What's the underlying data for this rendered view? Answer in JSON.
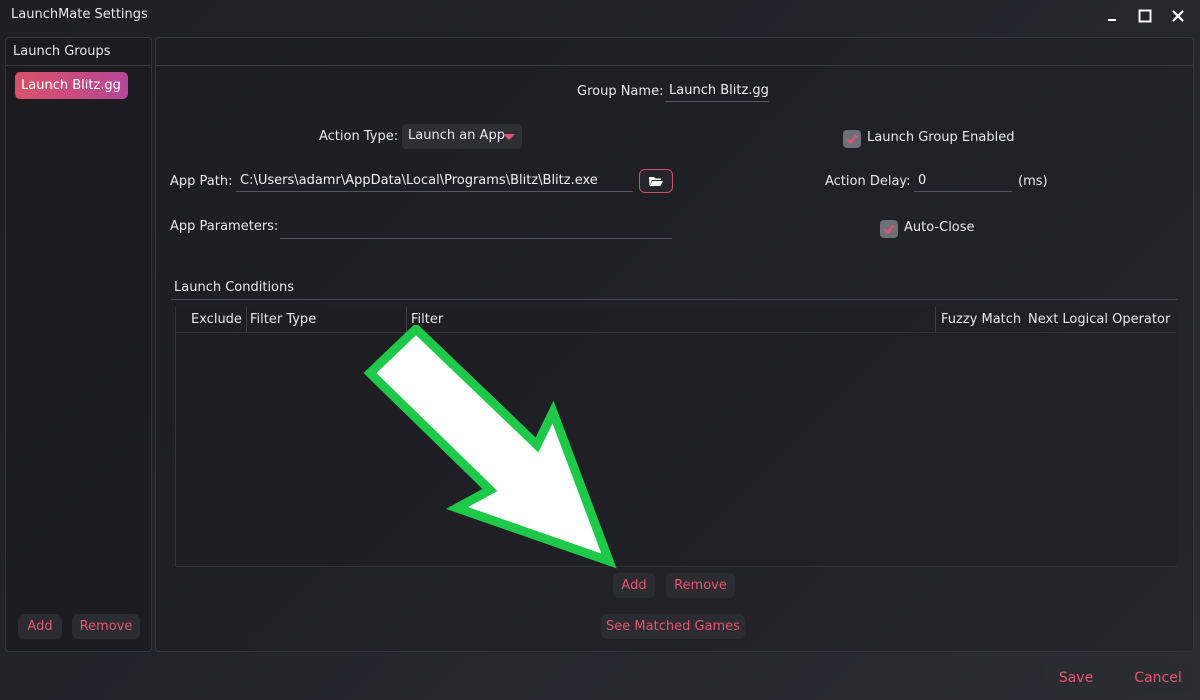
{
  "window": {
    "title": "LaunchMate Settings",
    "controls": [
      "minimize",
      "maximize",
      "close"
    ]
  },
  "sidebar": {
    "header": "Launch Groups",
    "items": [
      {
        "label": "Launch Blitz.gg",
        "selected": true
      }
    ],
    "add_label": "Add",
    "remove_label": "Remove"
  },
  "form": {
    "group_name_label": "Group Name:",
    "group_name_value": "Launch Blitz.gg",
    "action_type_label": "Action Type:",
    "action_type_value": "Launch an App",
    "launch_group_enabled_label": "Launch Group Enabled",
    "launch_group_enabled": true,
    "app_path_label": "App Path:",
    "app_path_value": "C:\\Users\\adamr\\AppData\\Local\\Programs\\Blitz\\Blitz.exe",
    "action_delay_label": "Action Delay:",
    "action_delay_value": "0",
    "action_delay_unit": "(ms)",
    "app_parameters_label": "App Parameters:",
    "app_parameters_value": "",
    "auto_close_label": "Auto-Close",
    "auto_close": true
  },
  "conditions": {
    "title": "Launch Conditions",
    "columns": [
      "Exclude",
      "Filter Type",
      "Filter",
      "Fuzzy Match",
      "Next Logical Operator"
    ],
    "rows": [],
    "add_label": "Add",
    "remove_label": "Remove",
    "see_matched_label": "See Matched Games"
  },
  "footer": {
    "save_label": "Save",
    "cancel_label": "Cancel"
  },
  "colors": {
    "accent": "#e05573",
    "annotation_arrow": "#1ec94a"
  },
  "icons": {
    "folder": "folder-open-icon",
    "minimize": "minimize-icon",
    "maximize": "maximize-icon",
    "close": "close-icon",
    "check": "checkmark-icon",
    "caret": "caret-down-icon"
  }
}
